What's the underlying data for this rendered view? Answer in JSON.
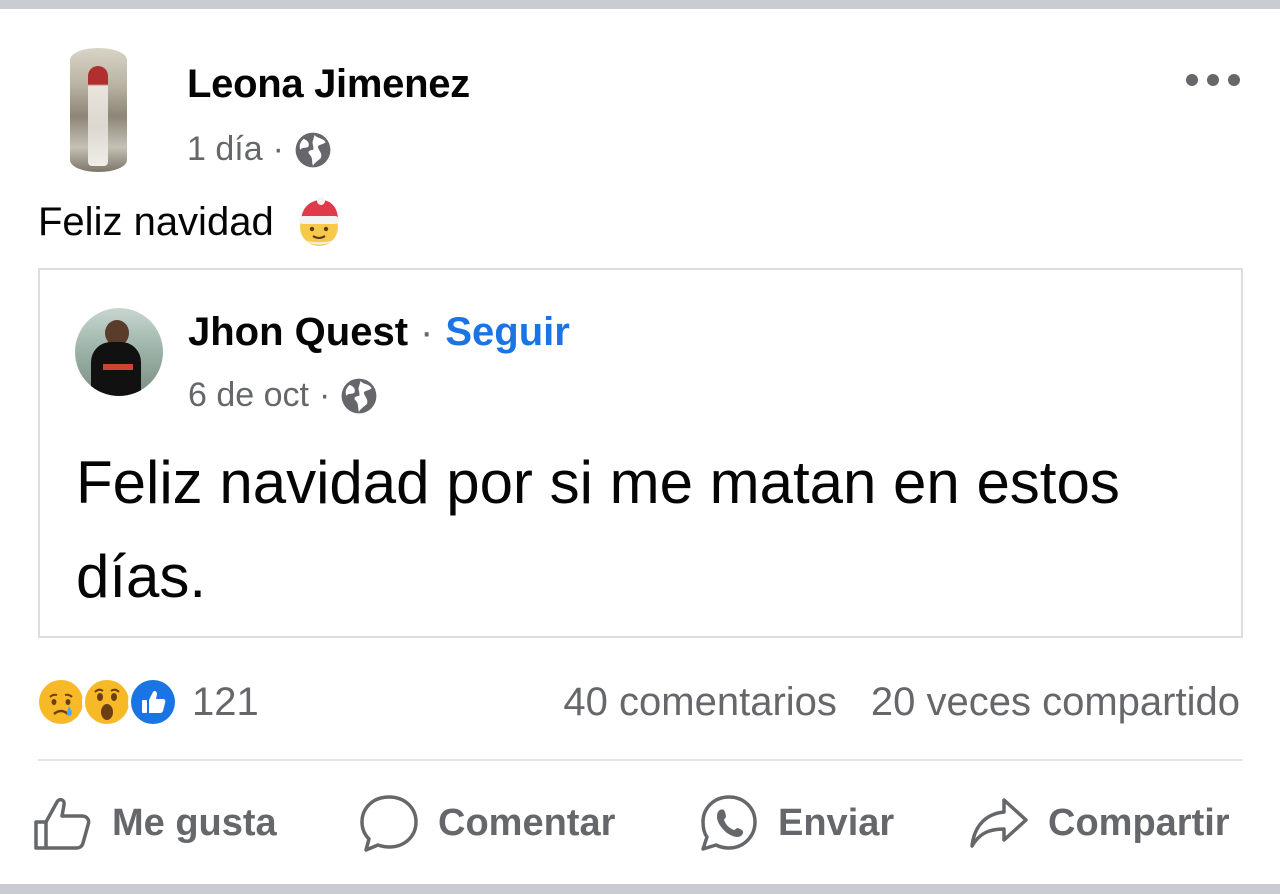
{
  "post": {
    "author": "Leona Jimenez",
    "time": "1 día",
    "separator": "·",
    "audience_icon": "globe-icon",
    "text": "Feliz navidad",
    "emoji": "santa-face-emoji"
  },
  "shared_post": {
    "author": "Jhon Quest",
    "separator": "·",
    "follow_label": "Seguir",
    "time": "6 de oct",
    "audience_icon": "globe-icon",
    "text": "Feliz navidad por si me matan en estos días."
  },
  "reactions": {
    "icons": [
      "sad-icon",
      "wow-icon",
      "like-icon"
    ],
    "count": "121"
  },
  "stats": {
    "comments": "40 comentarios",
    "shares": "20 veces compartido"
  },
  "actions": {
    "like": "Me gusta",
    "comment": "Comentar",
    "send": "Enviar",
    "share": "Compartir"
  },
  "colors": {
    "accent": "#1b74e4",
    "secondary_text": "#65676b",
    "divider": "#e4e6eb"
  }
}
